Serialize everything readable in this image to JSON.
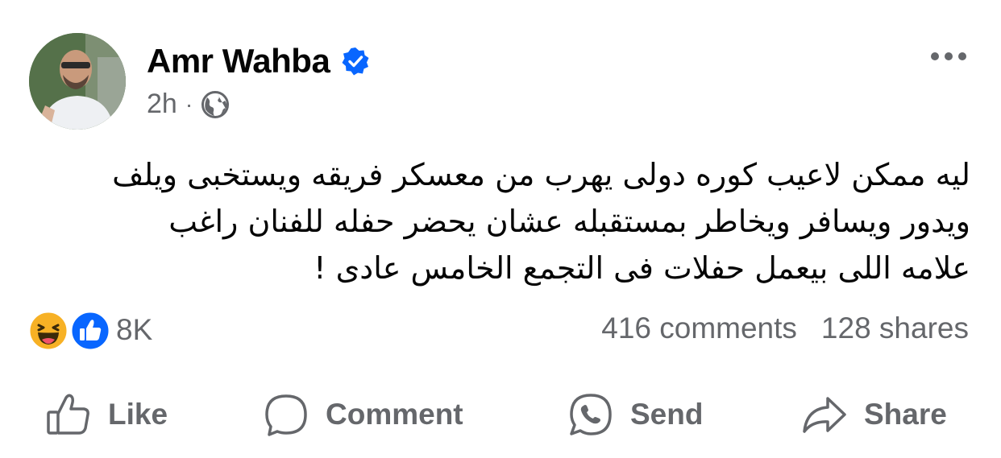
{
  "post": {
    "author": "Amr Wahba",
    "verified": true,
    "time": "2h",
    "separator": "·",
    "audience_icon": "globe-icon",
    "text_lines": [
      "ليه ممكن لاعيب كوره دولى يهرب من معسكر فريقه ويستخبى ويلف",
      "ويدور ويسافر ويخاطر بمستقبله عشان يحضر حفله للفنان راغب",
      "علامه اللى بيعمل حفلات فى التجمع الخامس عادى !"
    ]
  },
  "stats": {
    "reactions": "8K",
    "reaction_icons": [
      "haha-icon",
      "like-icon"
    ],
    "comments": "416 comments",
    "shares": "128 shares"
  },
  "actions": {
    "like": "Like",
    "comment": "Comment",
    "send": "Send",
    "share": "Share"
  },
  "colors": {
    "brand_blue": "#0866ff",
    "secondary_text": "#65676b",
    "haha_yellow": "#f7b125"
  }
}
